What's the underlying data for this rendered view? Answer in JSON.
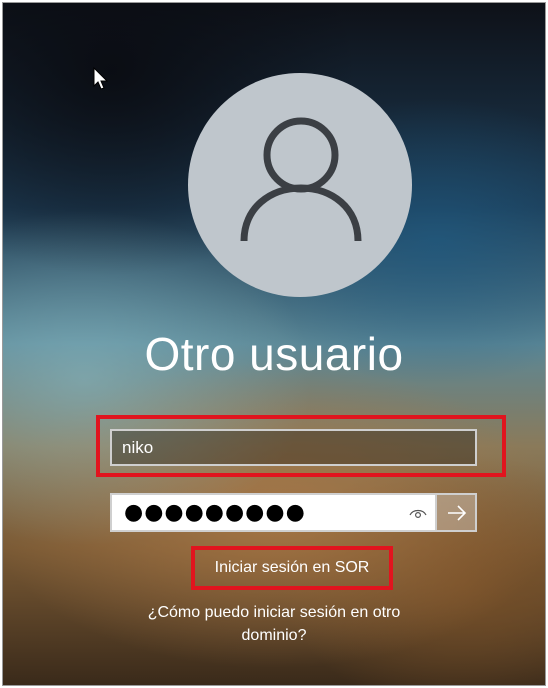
{
  "login": {
    "title": "Otro usuario",
    "username_value": "niko",
    "password_mask": "●●●●●●●●●",
    "sign_in_sor_label": "Iniciar sesión en SOR",
    "other_domain_line1": "¿Cómo puedo iniciar sesión en otro",
    "other_domain_line2": "dominio?"
  },
  "icons": {
    "cursor": "mouse-pointer-icon",
    "avatar": "user-silhouette-icon",
    "reveal": "eye-icon",
    "submit": "arrow-right-icon"
  },
  "colors": {
    "highlight": "#e1141e",
    "text": "#ffffff",
    "avatar_bg": "#bfc6cc"
  }
}
